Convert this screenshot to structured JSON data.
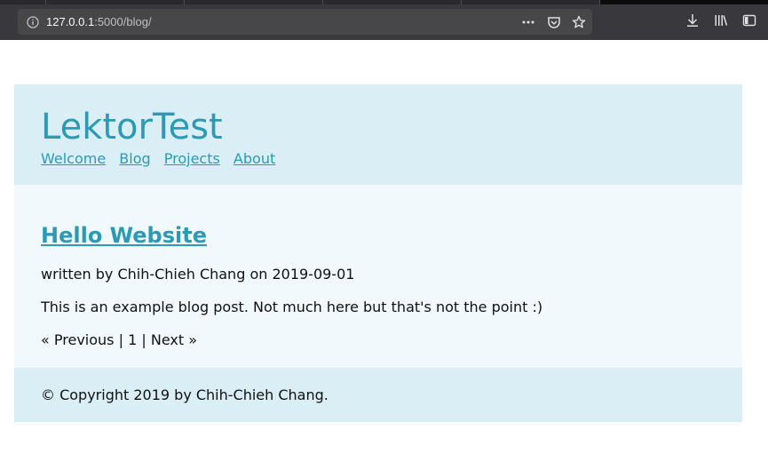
{
  "browser": {
    "url_host": "127.0.0.1",
    "url_rest": ":5000/blog/",
    "tab_count": 5
  },
  "site": {
    "title": "LektorTest",
    "nav": [
      {
        "label": "Welcome"
      },
      {
        "label": "Blog"
      },
      {
        "label": "Projects"
      },
      {
        "label": "About"
      }
    ]
  },
  "post": {
    "title": "Hello Website",
    "meta": "written by Chih-Chieh Chang on 2019-09-01",
    "body": "This is an example blog post. Not much here but that's not the point :)"
  },
  "pagination": {
    "previous": "« Previous",
    "sep1": "|",
    "page": "1",
    "sep2": "|",
    "next": "Next »"
  },
  "footer": {
    "text": "© Copyright 2019 by Chih-Chieh Chang."
  },
  "colors": {
    "accent": "#2d9ab5",
    "header_bg": "#daeef5",
    "content_bg": "#f1f9fc",
    "chrome_bg": "#38383d"
  },
  "icons": [
    "info-icon",
    "more-icon",
    "pocket-icon",
    "bookmark-star-icon",
    "download-icon",
    "library-icon",
    "sidebar-icon"
  ]
}
